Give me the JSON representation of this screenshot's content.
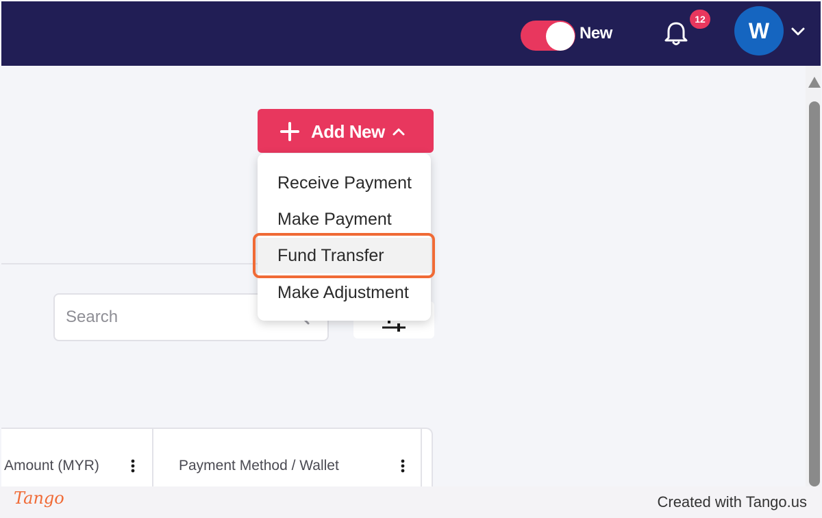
{
  "header": {
    "toggle_label": "New",
    "notification_count": "12",
    "avatar_initial": "W"
  },
  "toolbar": {
    "add_new_label": "Add New"
  },
  "menu": {
    "items": [
      {
        "label": "Receive Payment"
      },
      {
        "label": "Make Payment"
      },
      {
        "label": "Fund Transfer"
      },
      {
        "label": "Make Adjustment"
      }
    ]
  },
  "search": {
    "placeholder": "Search"
  },
  "table": {
    "columns": [
      {
        "label": "Amount (MYR)"
      },
      {
        "label": "Payment Method / Wallet"
      }
    ]
  },
  "footer": {
    "logo_text": "Tango",
    "credit": "Created with Tango.us"
  },
  "colors": {
    "topbar": "#211e55",
    "accent": "#e8375e",
    "highlight": "#f06a35",
    "avatar": "#1565c0"
  }
}
